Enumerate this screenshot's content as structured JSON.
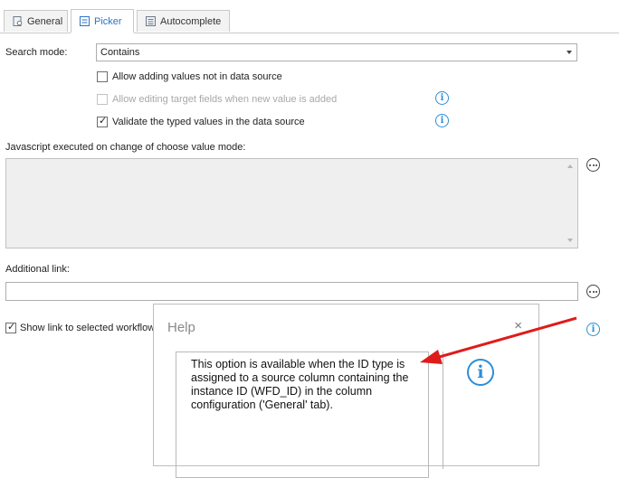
{
  "tabs": [
    {
      "label": "General",
      "icon": "gear-page-icon",
      "active": false
    },
    {
      "label": "Picker",
      "icon": "picker-icon",
      "active": true
    },
    {
      "label": "Autocomplete",
      "icon": "list-icon",
      "active": false
    }
  ],
  "search_mode": {
    "label": "Search mode:",
    "value": "Contains"
  },
  "checkboxes": [
    {
      "label": "Allow adding values not in data source",
      "checked": false,
      "disabled": false
    },
    {
      "label": "Allow editing target fields when new value is added",
      "checked": false,
      "disabled": true
    },
    {
      "label": "Validate the typed values in the data source",
      "checked": true,
      "disabled": false
    }
  ],
  "javascript": {
    "label": "Javascript executed on change of choose value mode:",
    "value": ""
  },
  "additional_link": {
    "label": "Additional link:",
    "value": ""
  },
  "show_link": {
    "label": "Show link to selected workflow",
    "checked": true
  },
  "help_dialog": {
    "title": "Help",
    "close": "×",
    "message": "This option is available when the ID type is assigned to a source column containing the instance ID (WFD_ID) in the column configuration ('General' tab)."
  },
  "icons": {
    "info": "i",
    "more": "…"
  },
  "colors": {
    "accent": "#2b73c7",
    "info": "#2b8fd8",
    "arrow": "#e01b1b"
  }
}
